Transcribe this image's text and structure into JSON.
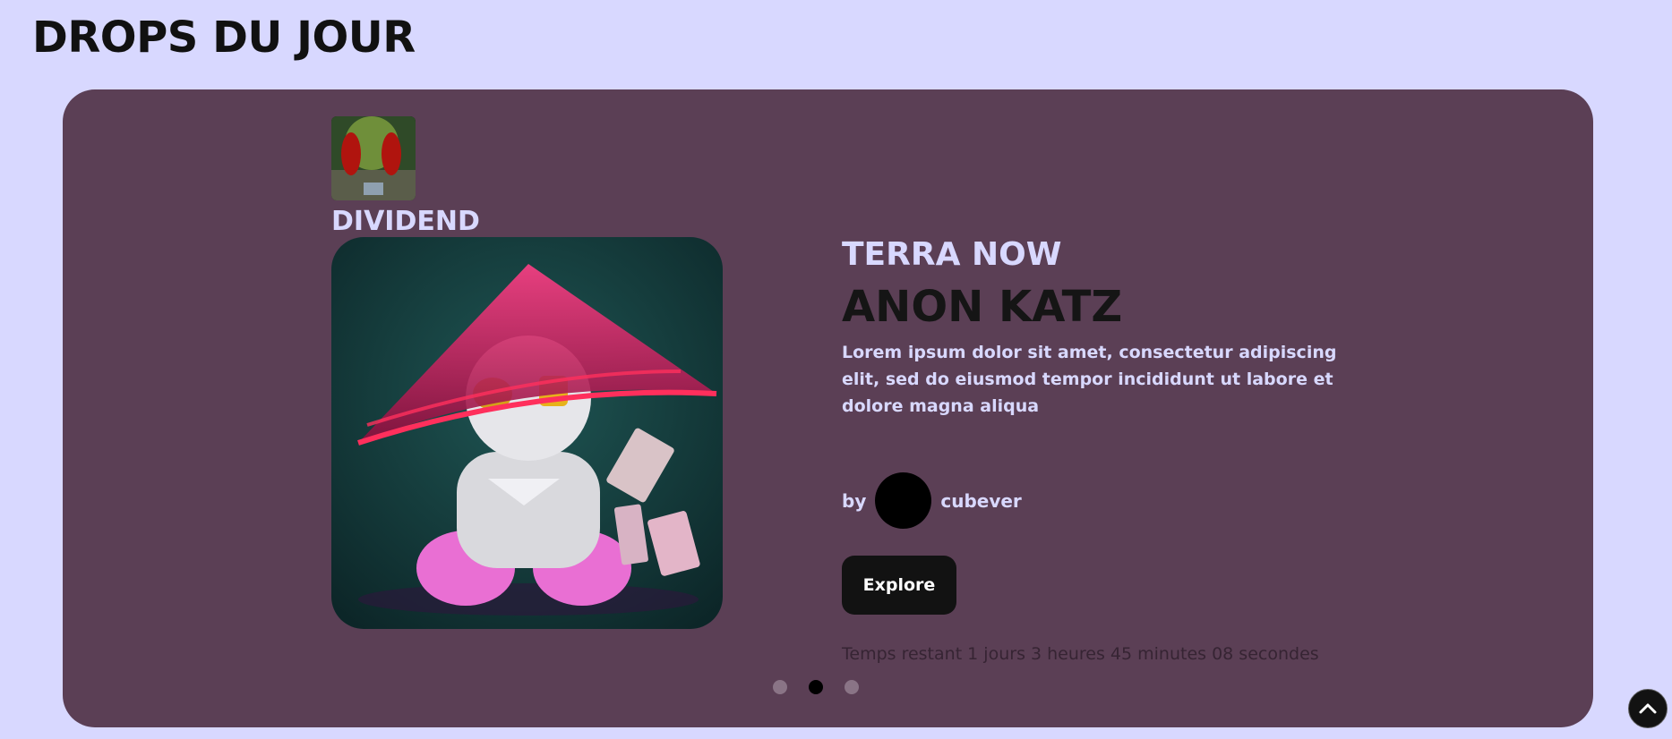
{
  "page": {
    "title": "DROPS DU JOUR"
  },
  "carousel": {
    "collection": {
      "name": "DIVIDEND"
    },
    "brand": "TERRA NOW",
    "nft_title": "ANON KATZ",
    "description": "Lorem ipsum dolor sit amet, consectetur adipiscing elit, sed do eiusmod tempor incididunt ut labore et dolore magna aliqua",
    "by_label": "by",
    "creator": "cubever",
    "explore_label": "Explore",
    "countdown": "Temps restant 1 jours 3 heures 45 minutes 08 secondes",
    "dots": {
      "count": 3,
      "active_index": 1
    }
  },
  "icons": {
    "scroll_top": "chevron-up-icon"
  },
  "colors": {
    "background": "#d8d8ff",
    "card": "#5b3f55",
    "accent_text": "#d8d8ff",
    "button": "#121212"
  }
}
